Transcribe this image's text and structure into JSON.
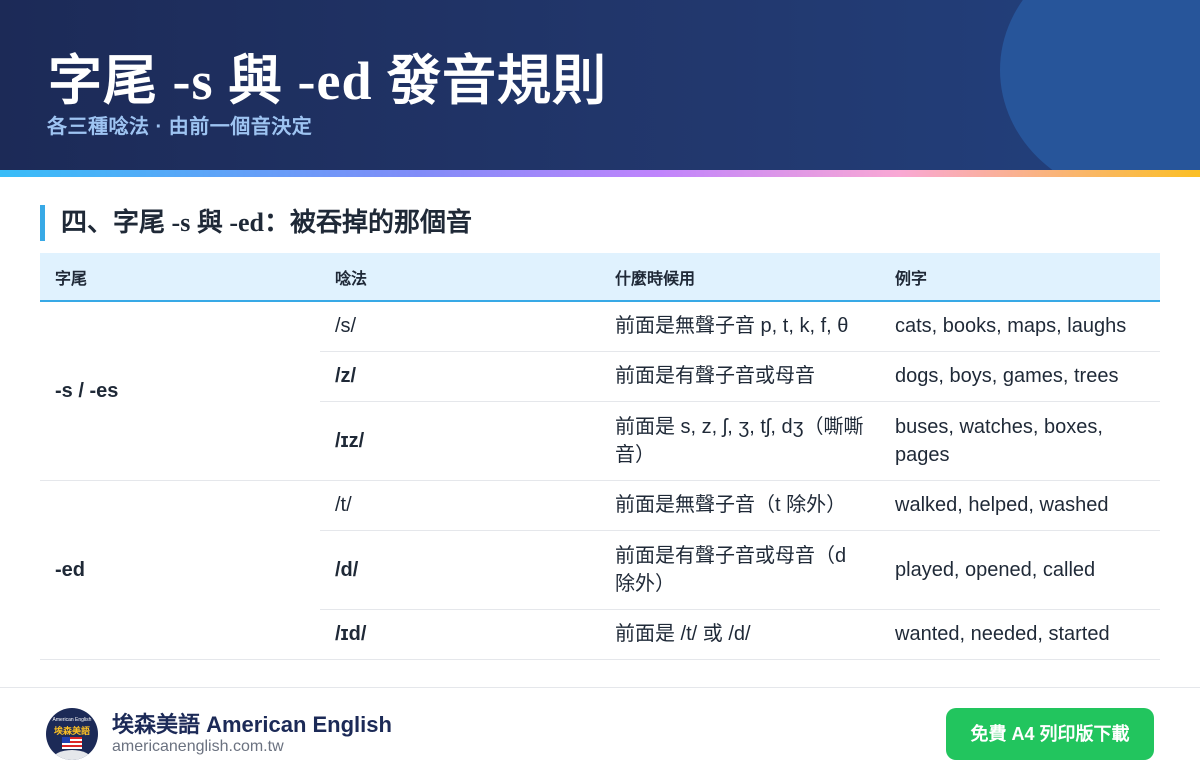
{
  "header": {
    "title": "字尾 -s 與 -ed 發音規則",
    "subtitle": "各三種唸法 · 由前一個音決定"
  },
  "section": {
    "number": "四、",
    "title_part1": "字尾 ",
    "title_s": "-s",
    "title_part2": " 與 ",
    "title_ed": "-ed",
    "title_part3": "：被吞掉的那個音"
  },
  "table": {
    "headers": [
      "字尾",
      "唸法",
      "什麼時候用",
      "例字"
    ],
    "groups": [
      {
        "suffix": "-s / -es",
        "rows": [
          {
            "sound": "/s/",
            "when": "前面是無聲子音 p, t, k, f, θ",
            "examples": "cats, books, maps, laughs"
          },
          {
            "sound": "/z/",
            "when": "前面是有聲子音或母音",
            "examples": "dogs, boys, games, trees"
          },
          {
            "sound": "/ɪz/",
            "when": "前面是 s, z, ʃ, ʒ, tʃ, dʒ（嘶嘶音）",
            "examples": "buses, watches, boxes, pages"
          }
        ]
      },
      {
        "suffix": "-ed",
        "rows": [
          {
            "sound": "/t/",
            "when": "前面是無聲子音（t 除外）",
            "examples": "walked, helped, washed"
          },
          {
            "sound": "/d/",
            "when": "前面是有聲子音或母音（d 除外）",
            "examples": "played, opened, called"
          },
          {
            "sound": "/ɪd/",
            "when": "前面是 /t/ 或 /d/",
            "examples": "wanted, needed, started"
          }
        ]
      }
    ]
  },
  "footer": {
    "logo_top": "American English",
    "logo_name": "埃森美語",
    "brand": "埃森美語 American English",
    "url": "americanenglish.com.tw",
    "download_label": "免費 A4 列印版下載"
  },
  "colors": {
    "header_bg": "#1c2a57",
    "accent": "#38a9e6",
    "table_header_bg": "#e0f2fe",
    "button": "#22c55e"
  }
}
